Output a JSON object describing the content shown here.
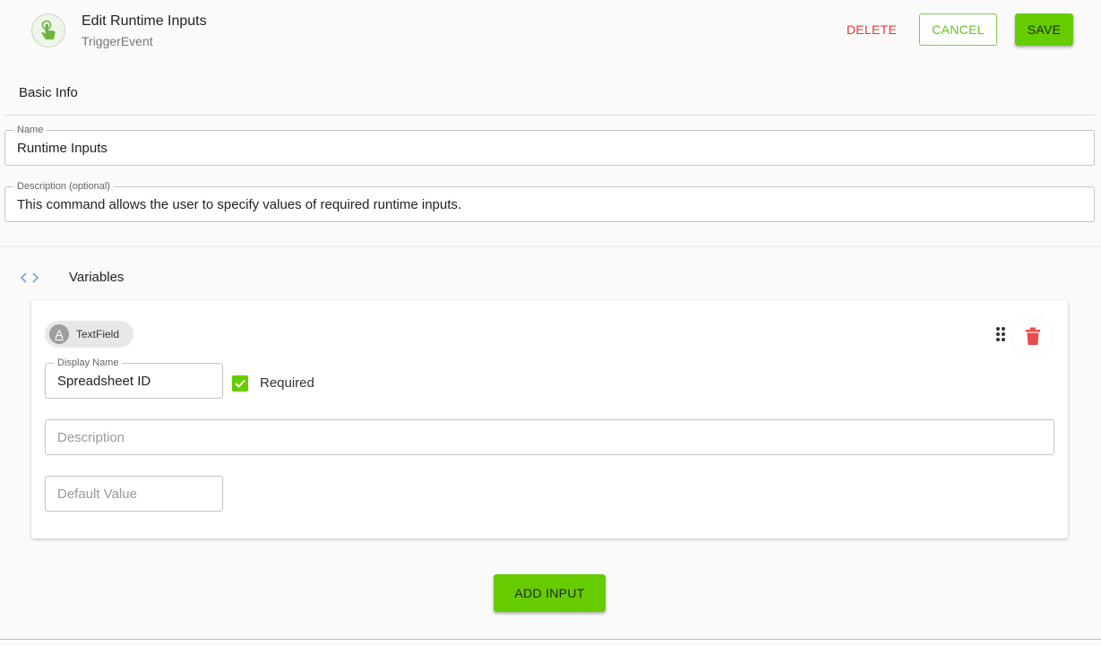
{
  "header": {
    "icon": "touch-hand-icon",
    "title": "Edit Runtime Inputs",
    "subtitle": "TriggerEvent",
    "delete_label": "DELETE",
    "cancel_label": "CANCEL",
    "save_label": "SAVE"
  },
  "basic_info": {
    "title": "Basic Info",
    "name_label": "Name",
    "name_value": "Runtime Inputs",
    "description_label": "Description (optional)",
    "description_value": "This command allows the user to specify values of required runtime inputs."
  },
  "variables": {
    "icon": "code-brackets-icon",
    "title": "Variables",
    "items": [
      {
        "type_chip": "TextField",
        "type_icon_letter": "A",
        "display_name_label": "Display Name",
        "display_name_value": "Spreadsheet ID",
        "required_label": "Required",
        "required_checked": true,
        "description_placeholder": "Description",
        "default_value_placeholder": "Default Value"
      }
    ]
  },
  "add_input_label": "ADD INPUT",
  "colors": {
    "accent_green": "#66cc00",
    "delete_red": "#e53935",
    "trash_red": "#e84c4c"
  }
}
